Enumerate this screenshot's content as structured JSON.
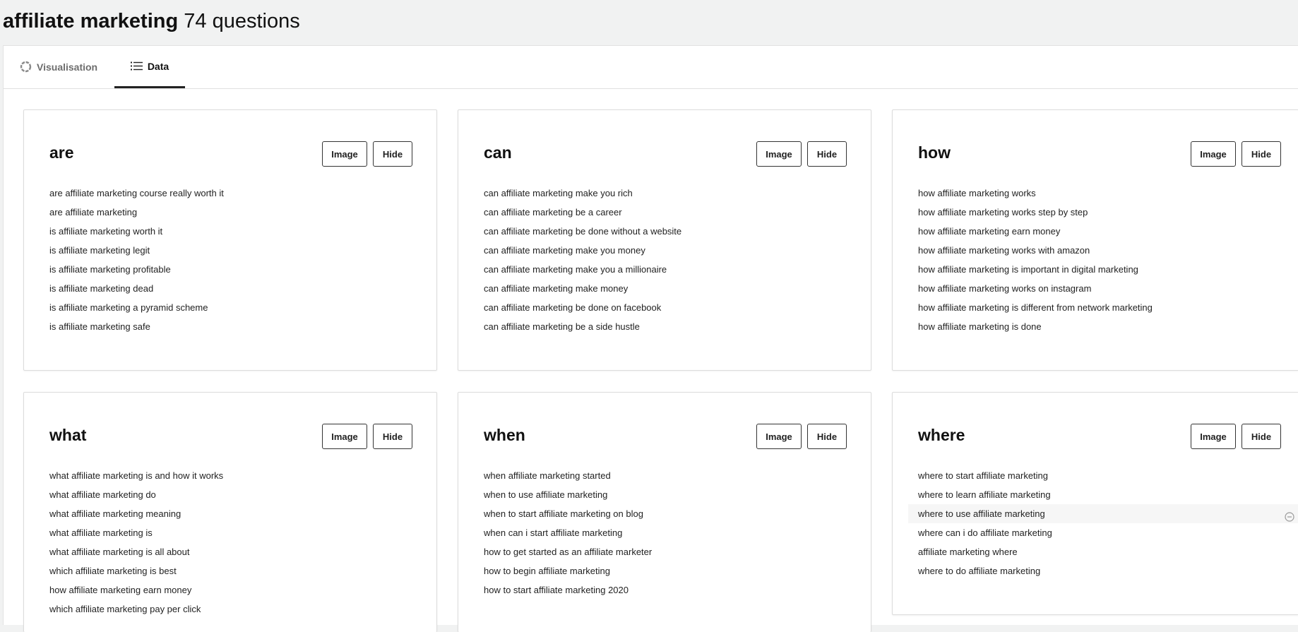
{
  "header": {
    "keyword": "affiliate marketing",
    "count_text": "74 questions"
  },
  "tabs": [
    {
      "label": "Visualisation",
      "icon": "circle-loader-icon",
      "active": false
    },
    {
      "label": "Data",
      "icon": "list-icon",
      "active": true
    }
  ],
  "buttons": {
    "image_label": "Image",
    "hide_label": "Hide"
  },
  "cards": [
    {
      "title": "are",
      "questions": [
        "are affiliate marketing course really worth it",
        "are affiliate marketing",
        "is affiliate marketing worth it",
        "is affiliate marketing legit",
        "is affiliate marketing profitable",
        "is affiliate marketing dead",
        "is affiliate marketing a pyramid scheme",
        "is affiliate marketing safe"
      ]
    },
    {
      "title": "can",
      "questions": [
        "can affiliate marketing make you rich",
        "can affiliate marketing be a career",
        "can affiliate marketing be done without a website",
        "can affiliate marketing make you money",
        "can affiliate marketing make you a millionaire",
        "can affiliate marketing make money",
        "can affiliate marketing be done on facebook",
        "can affiliate marketing be a side hustle"
      ]
    },
    {
      "title": "how",
      "questions": [
        "how affiliate marketing works",
        "how affiliate marketing works step by step",
        "how affiliate marketing earn money",
        "how affiliate marketing works with amazon",
        "how affiliate marketing is important in digital marketing",
        "how affiliate marketing works on instagram",
        "how affiliate marketing is different from network marketing",
        "how affiliate marketing is done"
      ]
    },
    {
      "title": "what",
      "questions": [
        "what affiliate marketing is and how it works",
        "what affiliate marketing do",
        "what affiliate marketing meaning",
        "what affiliate marketing is",
        "what affiliate marketing is all about",
        "which affiliate marketing is best",
        "how affiliate marketing earn money",
        "which affiliate marketing pay per click"
      ]
    },
    {
      "title": "when",
      "questions": [
        "when affiliate marketing started",
        "when to use affiliate marketing",
        "when to start affiliate marketing on blog",
        "when can i start affiliate marketing",
        "how to get started as an affiliate marketer",
        "how to begin affiliate marketing",
        "how to start affiliate marketing 2020"
      ]
    },
    {
      "title": "where",
      "questions": [
        "where to start affiliate marketing",
        "where to learn affiliate marketing",
        "where to use affiliate marketing",
        "where can i do affiliate marketing",
        "affiliate marketing where",
        "where to do affiliate marketing"
      ]
    }
  ]
}
